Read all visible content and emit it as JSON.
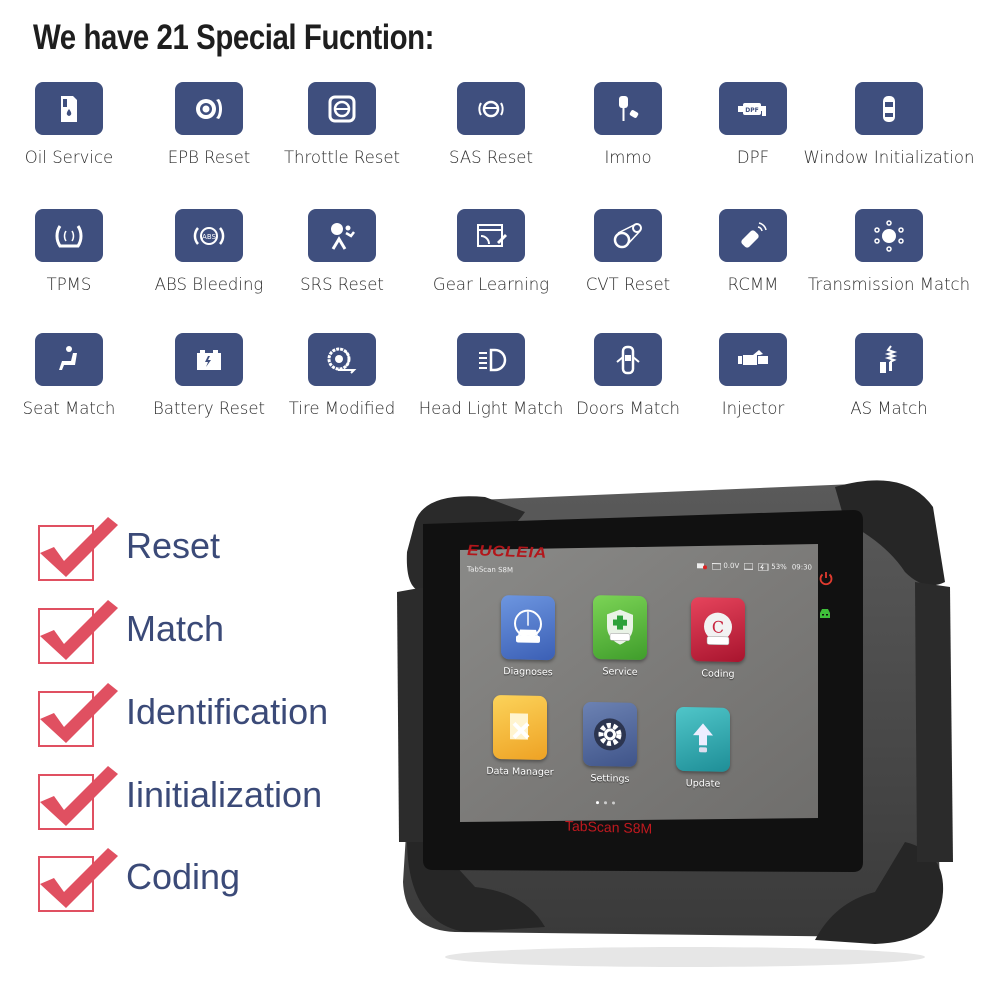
{
  "headline": "We have 21 Special Fucntion:",
  "functions": [
    {
      "label": "Oil Service",
      "icon": "oil-can-icon"
    },
    {
      "label": "EPB Reset",
      "icon": "brake-disc-icon"
    },
    {
      "label": "Throttle Reset",
      "icon": "throttle-body-icon"
    },
    {
      "label": "SAS Reset",
      "icon": "steering-wheel-icon"
    },
    {
      "label": "Immo",
      "icon": "car-key-icon"
    },
    {
      "label": "DPF",
      "icon": "dpf-filter-icon"
    },
    {
      "label": "Window Initialization",
      "icon": "car-top-view-icon"
    },
    {
      "label": "TPMS",
      "icon": "tire-pressure-icon"
    },
    {
      "label": "ABS Bleeding",
      "icon": "abs-icon"
    },
    {
      "label": "SRS Reset",
      "icon": "airbag-icon"
    },
    {
      "label": "Gear Learning",
      "icon": "gear-learning-icon"
    },
    {
      "label": "CVT Reset",
      "icon": "cvt-belt-icon"
    },
    {
      "label": "RCMM",
      "icon": "remote-key-icon"
    },
    {
      "label": "Transmission Match",
      "icon": "gear-shift-icon"
    },
    {
      "label": "Seat Match",
      "icon": "car-seat-icon"
    },
    {
      "label": "Battery Reset",
      "icon": "battery-icon"
    },
    {
      "label": "Tire Modified",
      "icon": "tire-icon"
    },
    {
      "label": "Head Light Match",
      "icon": "headlight-icon"
    },
    {
      "label": "Doors Match",
      "icon": "car-doors-icon"
    },
    {
      "label": "Injector",
      "icon": "injector-icon"
    },
    {
      "label": "AS Match",
      "icon": "suspension-icon"
    }
  ],
  "checklist": [
    "Reset",
    "Match",
    "Identification",
    "Iinitialization",
    "Coding"
  ],
  "colors": {
    "tile": "#3f4f7e",
    "check": "#e05061",
    "checklist_text": "#3b4a78"
  },
  "device": {
    "brand": "EUCLEIA",
    "model": "TabScan S8M",
    "screen_title": "TabScan S8M",
    "status": {
      "voltage": "0.0V",
      "battery": "53%",
      "time": "09:30"
    },
    "apps": [
      {
        "label": "Diagnoses",
        "icon": "diagnoses-icon",
        "color": "#4a74c8"
      },
      {
        "label": "Service",
        "icon": "service-shield-icon",
        "color": "#5cb83a"
      },
      {
        "label": "Coding",
        "icon": "coding-icon",
        "color": "#c8243e"
      },
      {
        "label": "Data Manager",
        "icon": "data-manager-icon",
        "color": "#f2b12d"
      },
      {
        "label": "Settings",
        "icon": "settings-gear-icon",
        "color": "#4f6597"
      },
      {
        "label": "Update",
        "icon": "update-arrow-icon",
        "color": "#2fa8b0"
      }
    ],
    "page_count": 3,
    "active_page": 1
  }
}
